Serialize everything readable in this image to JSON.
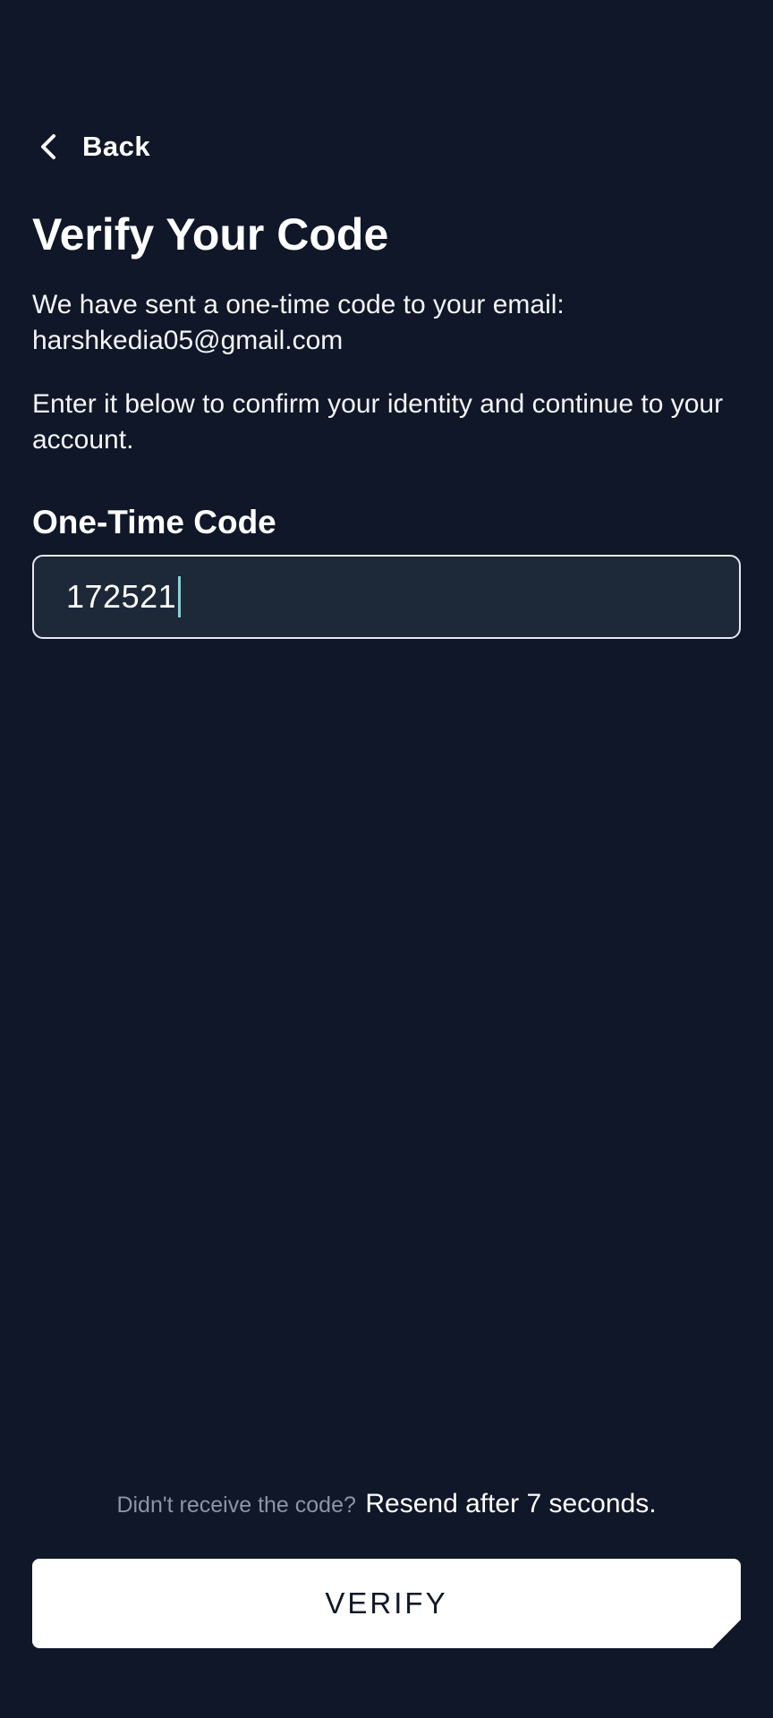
{
  "header": {
    "back_label": "Back",
    "back_icon": "chevron-left-icon"
  },
  "title": "Verify Your Code",
  "message": {
    "line1": "We have sent a one-time code to your email:",
    "email": "harshkedia05@gmail.com",
    "instruction": "Enter it below to confirm your identity and continue to your account."
  },
  "code_field": {
    "label": "One-Time Code",
    "value": "172521"
  },
  "resend": {
    "prompt": "Didn't receive the code?",
    "status": "Resend after 7 seconds."
  },
  "verify_button": {
    "label": "VERIFY"
  },
  "colors": {
    "background": "#0f1728",
    "field_background": "#1d2838",
    "caret": "#7fd6d6",
    "muted_text": "#8c95a3",
    "button_background": "#ffffff"
  }
}
